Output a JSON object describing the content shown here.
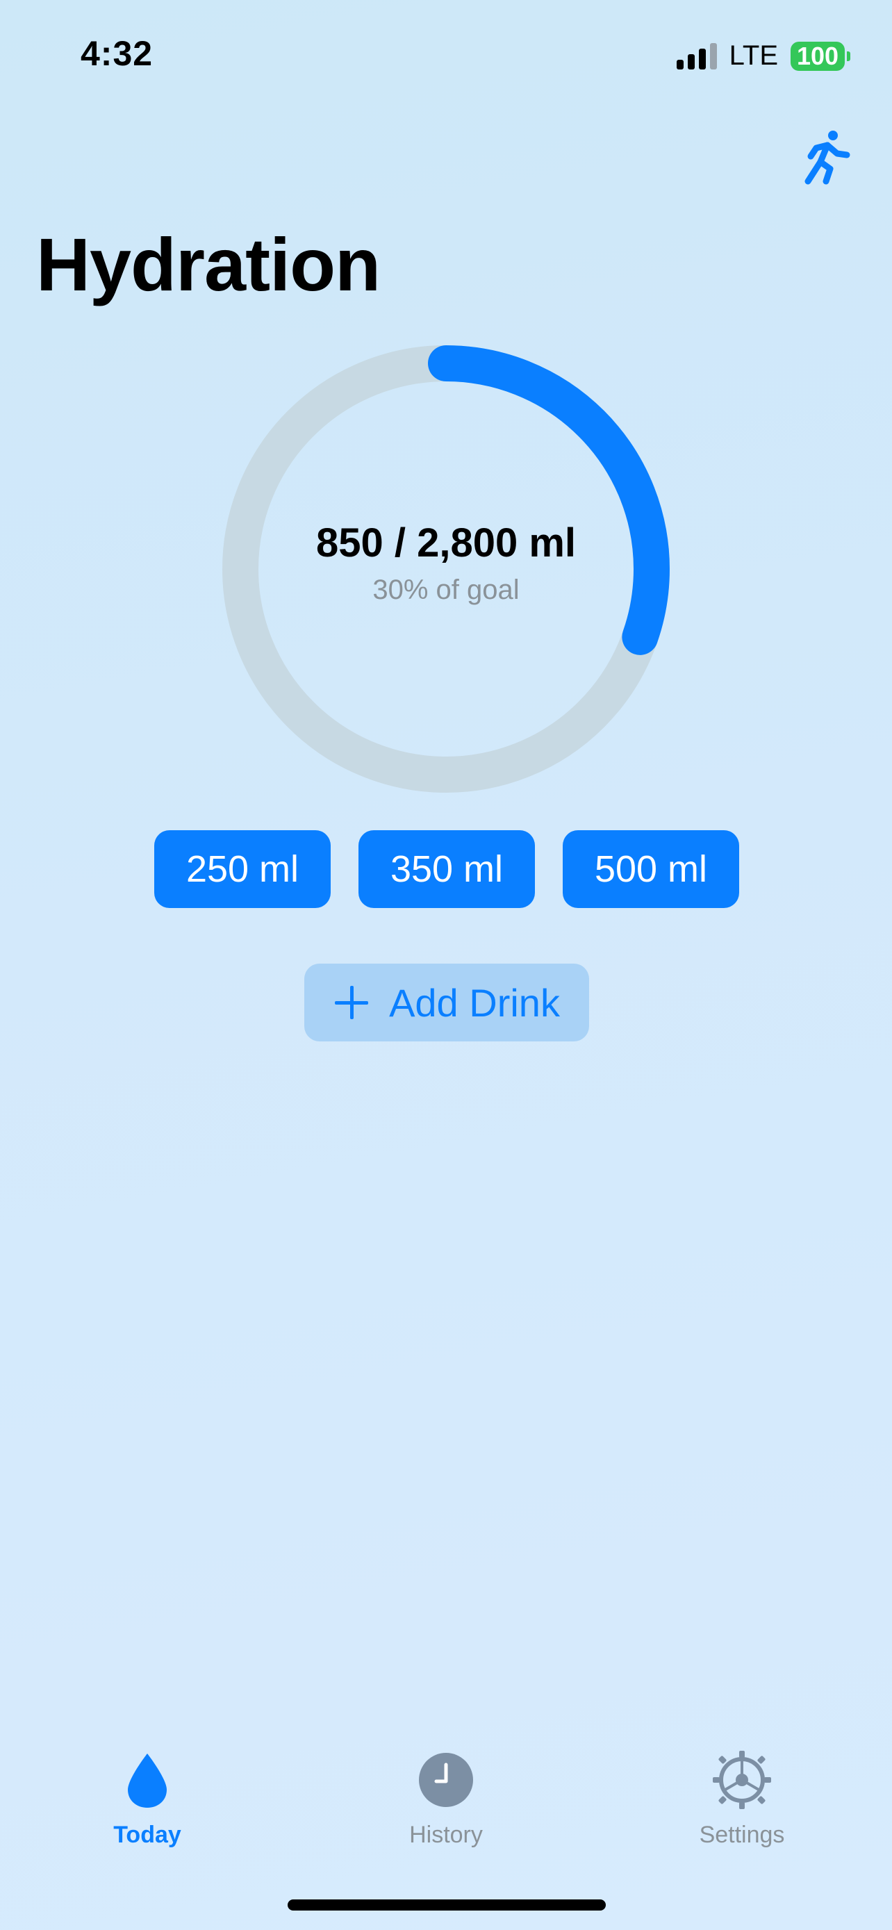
{
  "status_bar": {
    "time": "4:32",
    "network": "LTE",
    "battery": "100",
    "signal_bars": 3
  },
  "header": {
    "title": "Hydration",
    "workout_icon": "running-figure"
  },
  "progress": {
    "amount_text": "850 / 2,800 ml",
    "percent_text": "30% of goal",
    "fraction": 0.3036,
    "ring_color": "#0a7fff",
    "track_color": "#c7d9e3"
  },
  "quick_add": {
    "buttons": [
      "250 ml",
      "350 ml",
      "500 ml"
    ]
  },
  "add_drink": {
    "label": "Add Drink",
    "icon": "plus-icon"
  },
  "tabs": [
    {
      "label": "Today",
      "icon": "water-drop-icon",
      "active": true
    },
    {
      "label": "History",
      "icon": "clock-icon",
      "active": false
    },
    {
      "label": "Settings",
      "icon": "gear-icon",
      "active": false
    }
  ],
  "colors": {
    "accent": "#0a7fff",
    "battery": "#34c759",
    "inactive": "#8a9298"
  }
}
